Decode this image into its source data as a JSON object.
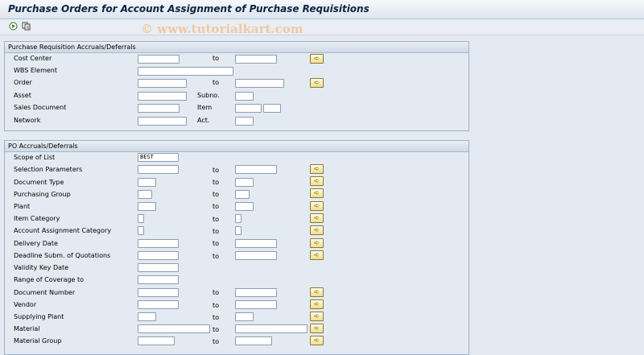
{
  "window": {
    "title": "Purchase Orders for Account Assignment of Purchase Requisitions"
  },
  "toolbar": {
    "icons": [
      "execute-icon",
      "get-variant-icon"
    ]
  },
  "watermark": "© www.tutorialkart.com",
  "section1": {
    "title": "Purchase Requisition Accruals/Deferrals",
    "cost_center": "Cost Center",
    "to1": "to",
    "wbs": "WBS Element",
    "order": "Order",
    "to2": "to",
    "asset": "Asset",
    "subno": "Subno.",
    "sales_doc": "Sales Document",
    "item": "Item",
    "network": "Network",
    "act": "Act."
  },
  "section2": {
    "title": "PO Accruals/Deferrals",
    "rows": [
      {
        "label": "Scope of List",
        "value": "BEST"
      },
      {
        "label": "Selection Parameters",
        "to": "to"
      },
      {
        "label": "Document Type",
        "to": "to"
      },
      {
        "label": "Purchasing Group",
        "to": "to"
      },
      {
        "label": "Plant",
        "to": "to"
      },
      {
        "label": "Item Category",
        "to": "to"
      },
      {
        "label": "Account Assignment Category",
        "to": "to"
      },
      {
        "label": "Delivery Date",
        "to": "to"
      },
      {
        "label": "Deadline Subm. of Quotations",
        "to": "to"
      },
      {
        "label": "Validity Key Date"
      },
      {
        "label": "Range of Coverage to"
      },
      {
        "label": "Document Number",
        "to": "to"
      },
      {
        "label": "Vendor",
        "to": "to"
      },
      {
        "label": "Supplying Plant",
        "to": "to"
      },
      {
        "label": "Material",
        "to": "to"
      },
      {
        "label": "Material Group",
        "to": "to"
      }
    ]
  }
}
